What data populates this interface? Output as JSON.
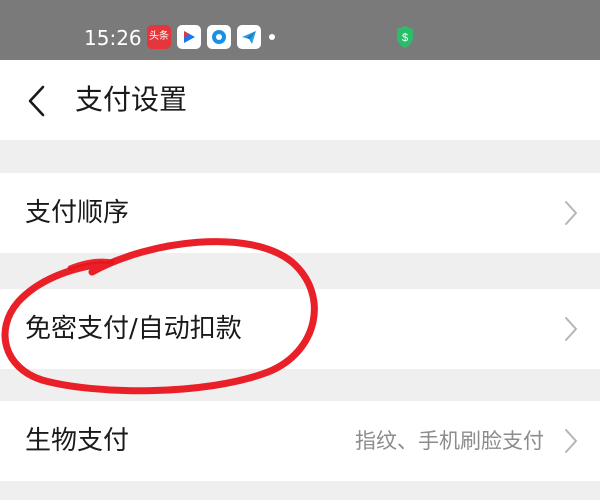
{
  "status_bar": {
    "time": "15:26",
    "icons": [
      "toutiao-app-icon",
      "video-app-icon",
      "circle-app-icon",
      "send-app-icon",
      "notification-dot",
      "shield-icon"
    ],
    "toutiao_text": "头条"
  },
  "header": {
    "back_icon": "chevron-left-icon",
    "title": "支付设置"
  },
  "settings": [
    {
      "label": "支付顺序",
      "value": ""
    },
    {
      "label": "免密支付/自动扣款",
      "value": ""
    },
    {
      "label": "生物支付",
      "value": "指纹、手机刷脸支付"
    }
  ],
  "colors": {
    "status_bar": "#7a7a7a",
    "page_bg": "#efefef",
    "row_bg": "#ffffff",
    "secondary_text": "#8c8c8c",
    "annotation_red": "#e8141c"
  }
}
